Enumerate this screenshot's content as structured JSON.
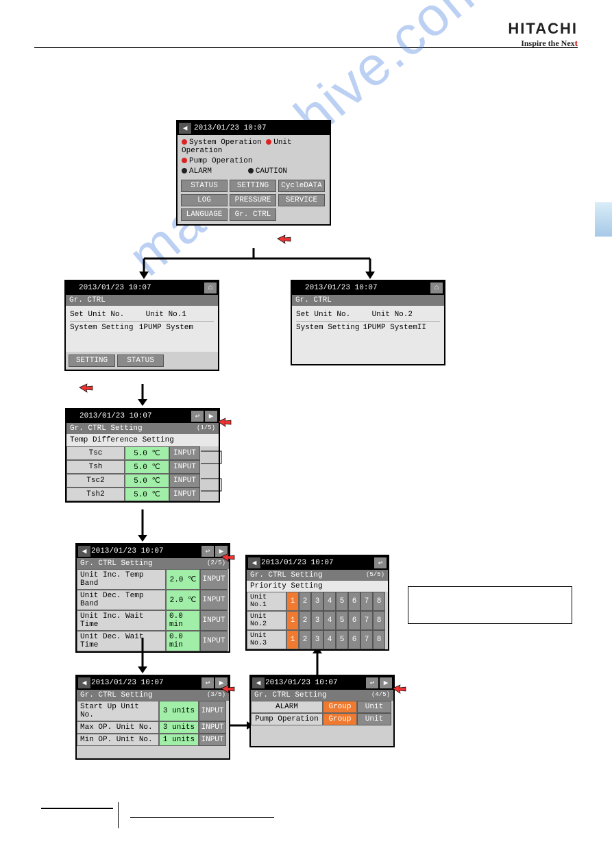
{
  "brand": {
    "logo": "HITACHI",
    "tag_prefix": "Inspire the Nex",
    "tag_suffix": "t"
  },
  "watermark": "manualshive.com",
  "ts": "2013/01/23 10:07",
  "panel_main": {
    "lines": {
      "sys_op": "System Operation",
      "unit_op": "Unit Operation",
      "pump_op": "Pump Operation",
      "alarm": "ALARM",
      "caution": "CAUTION"
    },
    "btns": {
      "status": "STATUS",
      "setting": "SETTING",
      "cycle": "CycleDATA",
      "log": "LOG",
      "pressure": "PRESSURE",
      "service": "SERVICE",
      "language": "LANGUAGE",
      "gr": "Gr. CTRL"
    }
  },
  "panel_ctrl_1": {
    "title": "Gr. CTRL",
    "set_label": "Set Unit No.",
    "set_val": "Unit No.1",
    "sys_label": "System Setting",
    "sys_val": "1PUMP System",
    "btn_setting": "SETTING",
    "btn_status": "STATUS"
  },
  "panel_ctrl_2": {
    "title": "Gr. CTRL",
    "set_label": "Set Unit No.",
    "set_val": "Unit No.2",
    "sys_label": "System Setting",
    "sys_val": "1PUMP SystemII"
  },
  "panel_set1": {
    "title": "Gr. CTRL Setting",
    "page": "(1/5)",
    "heading": "Temp Difference Setting",
    "rows": [
      {
        "name": "Tsc",
        "val": "5.0 ℃",
        "btn": "INPUT"
      },
      {
        "name": "Tsh",
        "val": "5.0 ℃",
        "btn": "INPUT"
      },
      {
        "name": "Tsc2",
        "val": "5.0 ℃",
        "btn": "INPUT"
      },
      {
        "name": "Tsh2",
        "val": "5.0 ℃",
        "btn": "INPUT"
      }
    ]
  },
  "panel_set2": {
    "title": "Gr. CTRL Setting",
    "page": "(2/5)",
    "rows": [
      {
        "name": "Unit Inc. Temp Band",
        "val": "2.0 ℃",
        "btn": "INPUT"
      },
      {
        "name": "Unit Dec. Temp Band",
        "val": "2.0 ℃",
        "btn": "INPUT"
      },
      {
        "name": "Unit Inc. Wait Time",
        "val": "0.0 min",
        "btn": "INPUT"
      },
      {
        "name": "Unit Dec. Wait Time",
        "val": "0.0 min",
        "btn": "INPUT"
      }
    ]
  },
  "panel_set3": {
    "title": "Gr. CTRL Setting",
    "page": "(3/5)",
    "rows": [
      {
        "name": "Start Up Unit No.",
        "val": "3 units",
        "btn": "INPUT"
      },
      {
        "name": "Max OP. Unit No.",
        "val": "3 units",
        "btn": "INPUT"
      },
      {
        "name": "Min OP. Unit No.",
        "val": "1 units",
        "btn": "INPUT"
      }
    ]
  },
  "panel_set4": {
    "title": "Gr. CTRL Setting",
    "page": "(4/5)",
    "rows": [
      {
        "name": "ALARM",
        "g": "Group",
        "u": "Unit"
      },
      {
        "name": "Pump Operation",
        "g": "Group",
        "u": "Unit"
      }
    ]
  },
  "panel_set5": {
    "title": "Gr. CTRL Setting",
    "page": "(5/5)",
    "heading": "Priority Setting",
    "rows": [
      {
        "name": "Unit No.1",
        "nums": [
          "1",
          "2",
          "3",
          "4",
          "5",
          "6",
          "7",
          "8"
        ]
      },
      {
        "name": "Unit No.2",
        "nums": [
          "1",
          "2",
          "3",
          "4",
          "5",
          "6",
          "7",
          "8"
        ]
      },
      {
        "name": "Unit No.3",
        "nums": [
          "1",
          "2",
          "3",
          "4",
          "5",
          "6",
          "7",
          "8"
        ]
      }
    ]
  }
}
